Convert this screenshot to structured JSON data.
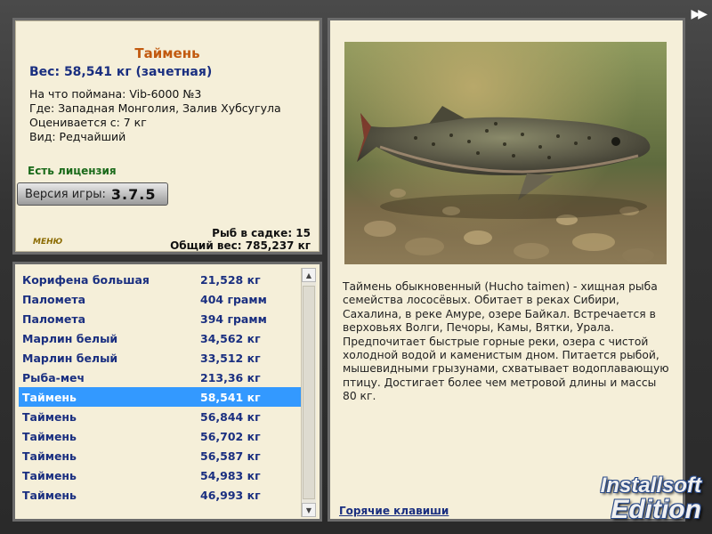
{
  "fish": {
    "name": "Таймень",
    "weight_line": "Вес: 58,541 кг (зачетная)",
    "bait_line": "На что поймана: Vib-6000 №3",
    "location_line": "Где: Западная Монголия, Залив Хубсугула",
    "rated_line": "Оценивается с: 7 кг",
    "kind_line": "Вид: Редчайший"
  },
  "license": "Есть лицензия",
  "version": {
    "label": "Версия игры:",
    "value": "3.7.5"
  },
  "menu_logo": "МЕНЮ",
  "keepnet": {
    "count_line": "Рыб в садке: 15",
    "total_line": "Общий вес: 785,237 кг"
  },
  "catch_list": [
    {
      "name": "Корифена большая",
      "weight": "21,528 кг"
    },
    {
      "name": "Паломета",
      "weight": "404 грамм"
    },
    {
      "name": "Паломета",
      "weight": "394 грамм"
    },
    {
      "name": "Марлин белый",
      "weight": "34,562 кг"
    },
    {
      "name": "Марлин белый",
      "weight": "33,512 кг"
    },
    {
      "name": "Рыба-меч",
      "weight": "213,36 кг"
    },
    {
      "name": "Таймень",
      "weight": "58,541 кг"
    },
    {
      "name": "Таймень",
      "weight": "56,844 кг"
    },
    {
      "name": "Таймень",
      "weight": "56,702 кг"
    },
    {
      "name": "Таймень",
      "weight": "56,587 кг"
    },
    {
      "name": "Таймень",
      "weight": "54,983 кг"
    },
    {
      "name": "Таймень",
      "weight": "46,993 кг"
    }
  ],
  "selected_index": 6,
  "description": "Таймень обыкновенный (Hucho taimen) - хищная рыба семейства лососёвых. Обитает в реках Сибири, Сахалина, в реке Амуре, озере Байкал. Встречается в верховьях Волги, Печоры, Камы, Вятки, Урала. Предпочитает быстрые горные реки, озера с чистой холодной водой и каменистым дном. Питается рыбой, мышевидными грызунами, схватывает водоплавающую птицу. Достигает более чем метровой длины и массы 80 кг.",
  "hotkeys_link": "Горячие клавиши",
  "watermark": {
    "line1": "Installsoft",
    "line2": "Edition"
  },
  "icons": {
    "next": "double-arrow-right-icon",
    "scroll_up": "arrow-up-icon",
    "scroll_down": "arrow-down-icon"
  }
}
